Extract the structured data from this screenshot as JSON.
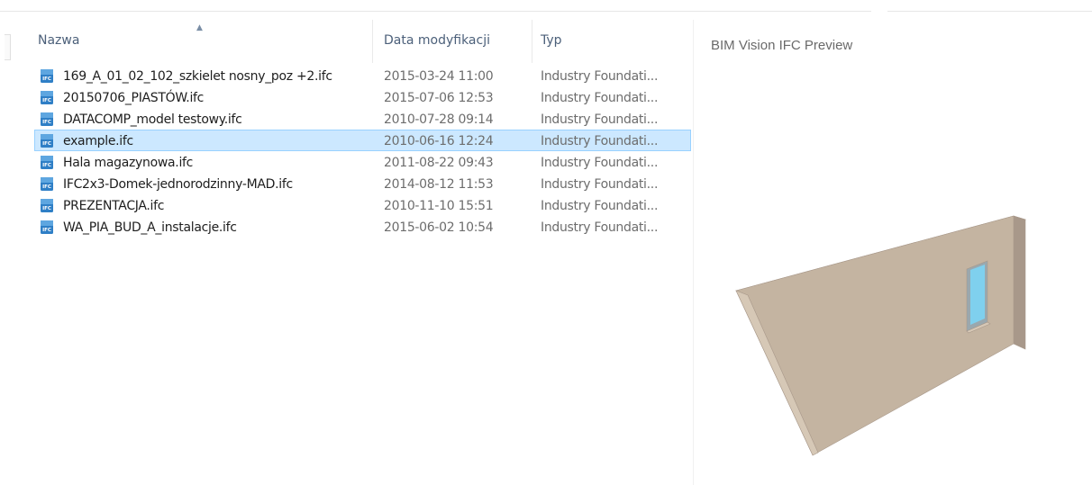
{
  "columns": {
    "name": "Nazwa",
    "date": "Data modyfikacji",
    "type": "Typ"
  },
  "files": [
    {
      "name": "169_A_01_02_102_szkielet nosny_poz +2.ifc",
      "date": "2015-03-24 11:00",
      "type": "Industry Foundati...",
      "selected": false
    },
    {
      "name": "20150706_PIASTÓW.ifc",
      "date": "2015-07-06 12:53",
      "type": "Industry Foundati...",
      "selected": false
    },
    {
      "name": "DATACOMP_model testowy.ifc",
      "date": "2010-07-28 09:14",
      "type": "Industry Foundati...",
      "selected": false
    },
    {
      "name": "example.ifc",
      "date": "2010-06-16 12:24",
      "type": "Industry Foundati...",
      "selected": true
    },
    {
      "name": "Hala magazynowa.ifc",
      "date": "2011-08-22 09:43",
      "type": "Industry Foundati...",
      "selected": false
    },
    {
      "name": "IFC2x3-Domek-jednorodzinny-MAD.ifc",
      "date": "2014-08-12 11:53",
      "type": "Industry Foundati...",
      "selected": false
    },
    {
      "name": "PREZENTACJA.ifc",
      "date": "2010-11-10 15:51",
      "type": "Industry Foundati...",
      "selected": false
    },
    {
      "name": "WA_PIA_BUD_A_instalacje.ifc",
      "date": "2015-06-02 10:54",
      "type": "Industry Foundati...",
      "selected": false
    }
  ],
  "file_icon": {
    "name": "ifc-file-icon",
    "glyph": "IFC",
    "color": "#2f7fc6"
  },
  "preview": {
    "title": "BIM Vision IFC Preview",
    "model_name": "wall-3d-model",
    "colors": {
      "wall_face": "#c4b4a1",
      "wall_top": "#d6c8b6",
      "wall_edge": "#a8988a",
      "window_glass": "#7fd0ee",
      "window_frame": "#9aa8ae"
    }
  },
  "colors": {
    "selection_bg": "#cce8ff",
    "selection_border": "#99d1ff",
    "header_text": "#4c607a"
  }
}
